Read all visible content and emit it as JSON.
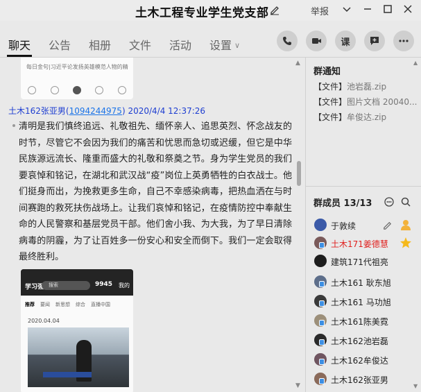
{
  "window": {
    "title": "土木工程专业学生党支部",
    "report_label": "举报"
  },
  "tabs": [
    {
      "label": "聊天",
      "active": true
    },
    {
      "label": "公告"
    },
    {
      "label": "相册"
    },
    {
      "label": "文件"
    },
    {
      "label": "活动"
    },
    {
      "label": "设置"
    }
  ],
  "toolbar": {
    "lesson_label": "课"
  },
  "chat": {
    "top_image_caption": "每日金句|习近平论发扬英雄模范人物的精",
    "message": {
      "sender_name": "土木162张亚男",
      "sender_qq": "1094244975",
      "timestamp": "2020/4/4 12:37:26",
      "text": "清明是我们慎终追远、礼敬祖先、缅怀亲人、追思英烈、怀念战友的时节，尽管它不会因为我们的痛苦和忧思而急切或迟缓，但它是中华民族源远流长、隆重而盛大的礼敬和祭奠之节。身为学生党员的我们要哀悼和铭记，在湖北和武汉战“疫”岗位上英勇牺牲的白衣战士。他们挺身而出，为挽救更多生命，自己不幸感染病毒，把热血洒在与时间赛跑的救死扶伤战场上。让我们哀悼和铭记，在疫情防控中奉献生命的人民警察和基层党员干部。他们舍小我、为大我，为了早日清除病毒的阴霾，为了让百姓多一份安心和安全而倒下。我们一定会取得最终胜利。"
    },
    "image": {
      "logo": "学习强国",
      "search": "搜索",
      "score": "9945",
      "mine": "我的",
      "tabs": [
        "推荐",
        "要闻",
        "新思想",
        "综合",
        "直播中国"
      ],
      "date": "2020.04.04"
    }
  },
  "notice": {
    "title": "群通知",
    "items": [
      {
        "tag": "【文件】",
        "name": "池岩磊.zip"
      },
      {
        "tag": "【文件】",
        "name": "图片文档 20040..."
      },
      {
        "tag": "【文件】",
        "name": "牟俊达.zip"
      }
    ]
  },
  "members": {
    "title": "群成员",
    "count": "13/13",
    "list": [
      {
        "name": "于敦续",
        "avatar_color": "#3b5aa8"
      },
      {
        "name": "土木171姜德慧",
        "avatar_color": "#7a5a5a",
        "owner": true
      },
      {
        "name": "建筑171代祖亮",
        "avatar_color": "#1d1d1d"
      },
      {
        "name": "土木161  耿东旭",
        "avatar_color": "#5d6e8a"
      },
      {
        "name": "土木161 马功旭",
        "avatar_color": "#3a3a3a"
      },
      {
        "name": "土木161陈美霓",
        "avatar_color": "#9c8f7a"
      },
      {
        "name": "土木162池岩磊",
        "avatar_color": "#2a2a2a"
      },
      {
        "name": "土木162牟俊达",
        "avatar_color": "#6f5560"
      },
      {
        "name": "土木162张亚男",
        "avatar_color": "#8a6a5a"
      }
    ]
  }
}
